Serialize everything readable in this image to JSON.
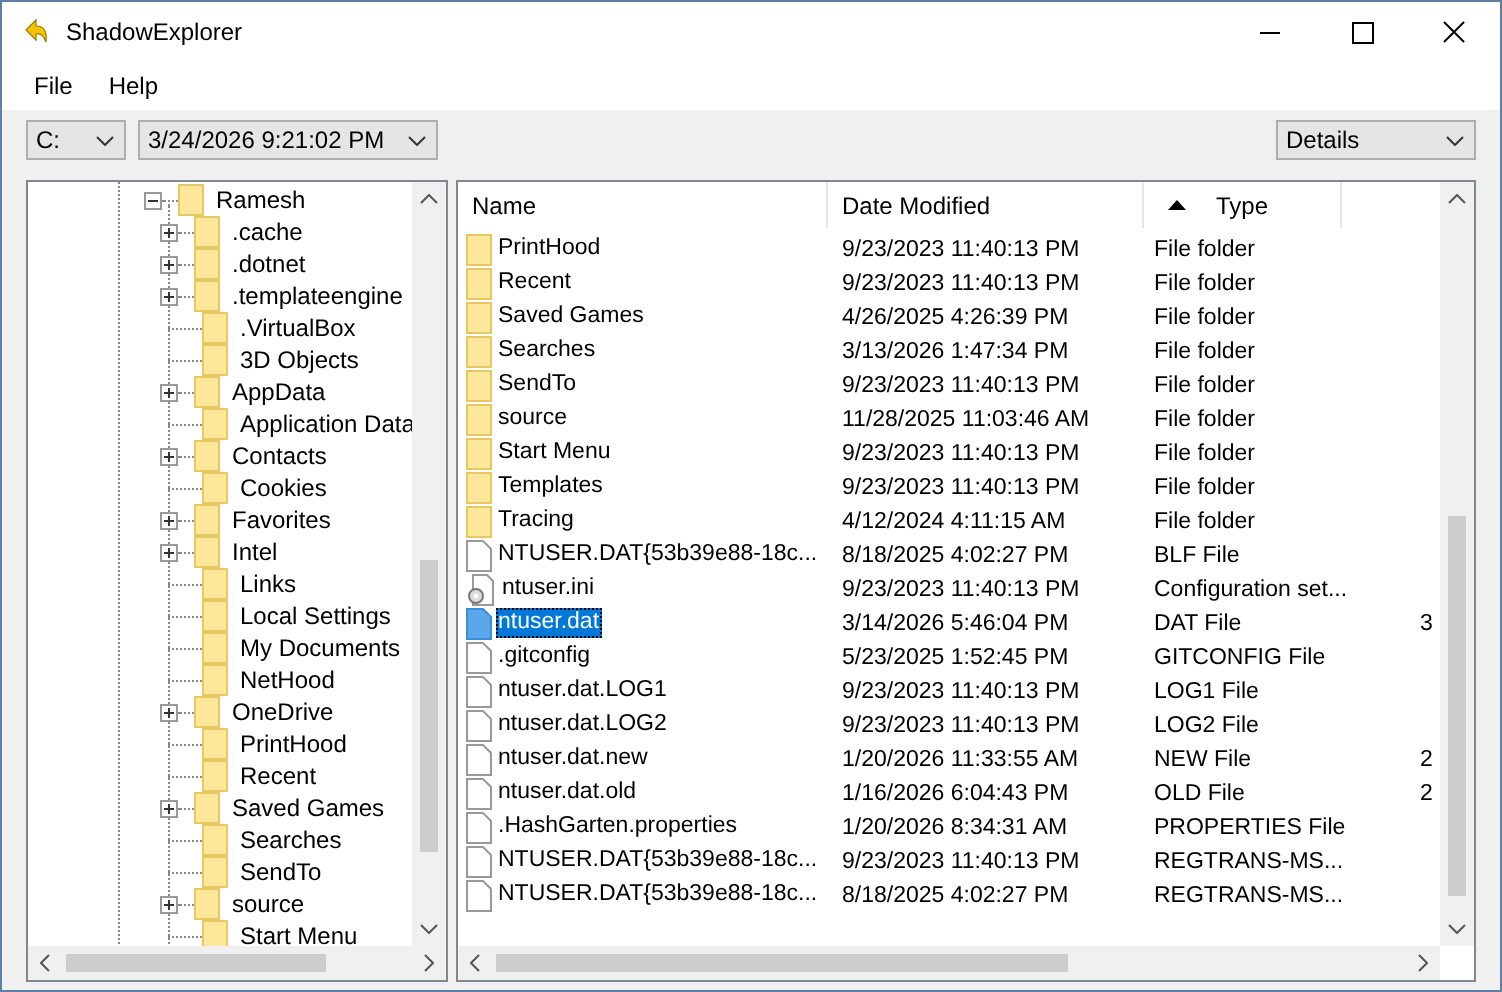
{
  "window": {
    "title": "ShadowExplorer"
  },
  "menu": [
    "File",
    "Help"
  ],
  "toolbar": {
    "drive": "C:",
    "snapshot": "3/24/2026 9:21:02 PM",
    "view": "Details"
  },
  "tree": {
    "label": "Ramesh",
    "expanded": true,
    "children": [
      {
        "label": ".cache",
        "expandable": true
      },
      {
        "label": ".dotnet",
        "expandable": true
      },
      {
        "label": ".templateengine",
        "expandable": true
      },
      {
        "label": ".VirtualBox",
        "expandable": false
      },
      {
        "label": "3D Objects",
        "expandable": false
      },
      {
        "label": "AppData",
        "expandable": true
      },
      {
        "label": "Application Data",
        "expandable": false
      },
      {
        "label": "Contacts",
        "expandable": true
      },
      {
        "label": "Cookies",
        "expandable": false
      },
      {
        "label": "Favorites",
        "expandable": true
      },
      {
        "label": "Intel",
        "expandable": true
      },
      {
        "label": "Links",
        "expandable": false
      },
      {
        "label": "Local Settings",
        "expandable": false
      },
      {
        "label": "My Documents",
        "expandable": false
      },
      {
        "label": "NetHood",
        "expandable": false
      },
      {
        "label": "OneDrive",
        "expandable": true
      },
      {
        "label": "PrintHood",
        "expandable": false
      },
      {
        "label": "Recent",
        "expandable": false
      },
      {
        "label": "Saved Games",
        "expandable": true
      },
      {
        "label": "Searches",
        "expandable": false
      },
      {
        "label": "SendTo",
        "expandable": false
      },
      {
        "label": "source",
        "expandable": true
      },
      {
        "label": "Start Menu",
        "expandable": false
      }
    ]
  },
  "table": {
    "columns": [
      {
        "label": "Name",
        "sorted": false
      },
      {
        "label": "Date Modified",
        "sorted": false
      },
      {
        "label": "Type",
        "sorted": true
      }
    ],
    "rows": [
      {
        "kind": "folder",
        "name": "PrintHood",
        "date": "9/23/2023 11:40:13 PM",
        "type": "File folder",
        "selected": false
      },
      {
        "kind": "folder",
        "name": "Recent",
        "date": "9/23/2023 11:40:13 PM",
        "type": "File folder",
        "selected": false
      },
      {
        "kind": "folder",
        "name": "Saved Games",
        "date": "4/26/2025 4:26:39 PM",
        "type": "File folder",
        "selected": false
      },
      {
        "kind": "folder",
        "name": "Searches",
        "date": "3/13/2026 1:47:34 PM",
        "type": "File folder",
        "selected": false
      },
      {
        "kind": "folder",
        "name": "SendTo",
        "date": "9/23/2023 11:40:13 PM",
        "type": "File folder",
        "selected": false
      },
      {
        "kind": "folder",
        "name": "source",
        "date": "11/28/2025 11:03:46 AM",
        "type": "File folder",
        "selected": false
      },
      {
        "kind": "folder",
        "name": "Start Menu",
        "date": "9/23/2023 11:40:13 PM",
        "type": "File folder",
        "selected": false
      },
      {
        "kind": "folder",
        "name": "Templates",
        "date": "9/23/2023 11:40:13 PM",
        "type": "File folder",
        "selected": false
      },
      {
        "kind": "folder",
        "name": "Tracing",
        "date": "4/12/2024 4:11:15 AM",
        "type": "File folder",
        "selected": false
      },
      {
        "kind": "file",
        "name": "NTUSER.DAT{53b39e88-18c...",
        "date": "8/18/2025 4:02:27 PM",
        "type": "BLF File",
        "selected": false
      },
      {
        "kind": "config",
        "name": "ntuser.ini",
        "date": "9/23/2023 11:40:13 PM",
        "type": "Configuration set...",
        "selected": false
      },
      {
        "kind": "file",
        "name": "ntuser.dat",
        "date": "3/14/2026 5:46:04 PM",
        "type": "DAT File",
        "column_4": "3",
        "selected": true
      },
      {
        "kind": "file",
        "name": ".gitconfig",
        "date": "5/23/2025 1:52:45 PM",
        "type": "GITCONFIG File",
        "selected": false
      },
      {
        "kind": "file",
        "name": "ntuser.dat.LOG1",
        "date": "9/23/2023 11:40:13 PM",
        "type": "LOG1 File",
        "selected": false
      },
      {
        "kind": "file",
        "name": "ntuser.dat.LOG2",
        "date": "9/23/2023 11:40:13 PM",
        "type": "LOG2 File",
        "selected": false
      },
      {
        "kind": "file",
        "name": "ntuser.dat.new",
        "date": "1/20/2026 11:33:55 AM",
        "type": "NEW File",
        "column_4": "2",
        "selected": false
      },
      {
        "kind": "file",
        "name": "ntuser.dat.old",
        "date": "1/16/2026 6:04:43 PM",
        "type": "OLD File",
        "column_4": "2",
        "selected": false
      },
      {
        "kind": "file",
        "name": ".HashGarten.properties",
        "date": "1/20/2026 8:34:31 AM",
        "type": "PROPERTIES File",
        "selected": false
      },
      {
        "kind": "file",
        "name": "NTUSER.DAT{53b39e88-18c...",
        "date": "9/23/2023 11:40:13 PM",
        "type": "REGTRANS-MS...",
        "selected": false
      },
      {
        "kind": "file",
        "name": "NTUSER.DAT{53b39e88-18c...",
        "date": "8/18/2025 4:02:27 PM",
        "type": "REGTRANS-MS...",
        "selected": false
      }
    ]
  }
}
